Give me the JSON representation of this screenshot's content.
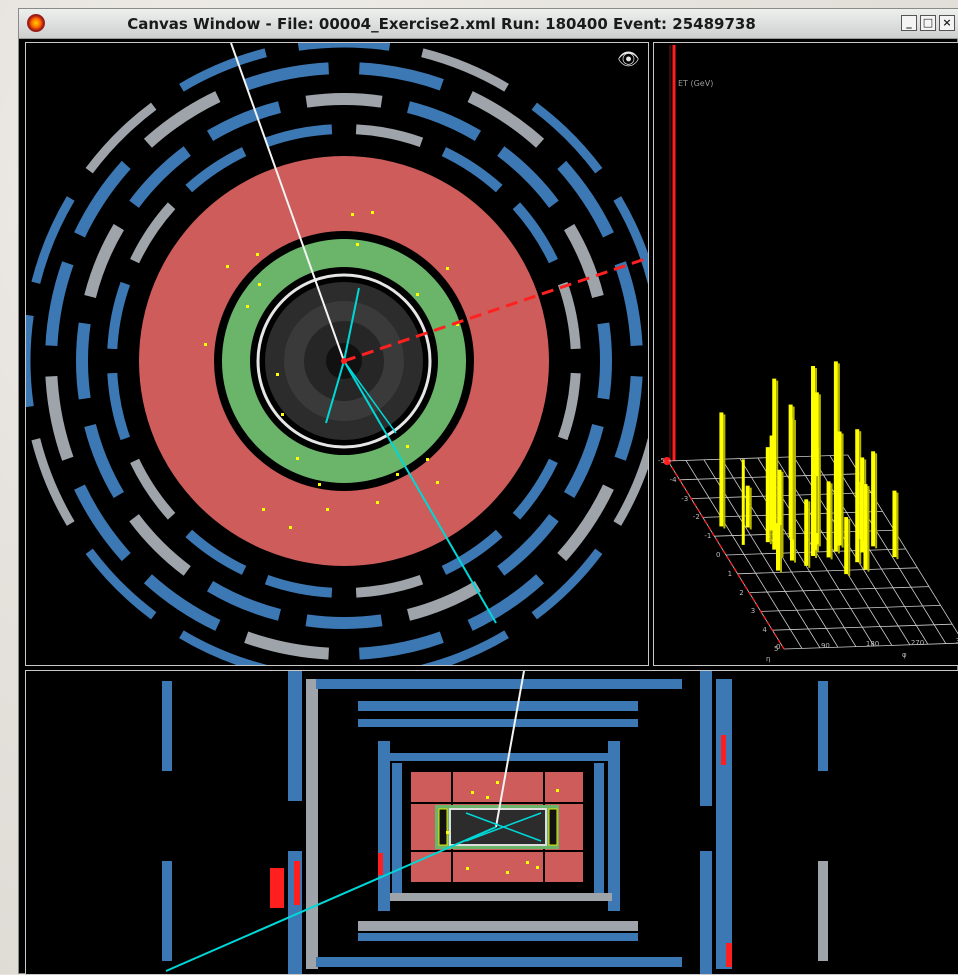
{
  "window": {
    "title": "Canvas Window -  File: 00004_Exercise2.xml  Run: 180400  Event: 25489738",
    "minimize_glyph": "_",
    "maximize_glyph": "□",
    "close_glyph": "×"
  },
  "lego_plot": {
    "z_label": "ET (GeV)",
    "eta_ticks": [
      "-5",
      "-4",
      "-3",
      "-2",
      "-1",
      "0",
      "1",
      "2",
      "3",
      "4",
      "5"
    ],
    "phi_ticks": [
      "0",
      "90",
      "180",
      "270",
      "360"
    ],
    "phi_label": "φ",
    "eta_label": "η"
  },
  "icons": {
    "view_eye": "eye-icon"
  },
  "colors": {
    "background": "#000000",
    "lar_calorimeter": "#cd5c5a",
    "tile_calorimeter_ring": "#6bb56b",
    "muon_chamber": "#3c78b4",
    "muon_chamber_grey": "#9ea4aa",
    "track": "#00e0e0",
    "missing_et": "#ff2020",
    "energy_deposit": "#ffff00"
  }
}
